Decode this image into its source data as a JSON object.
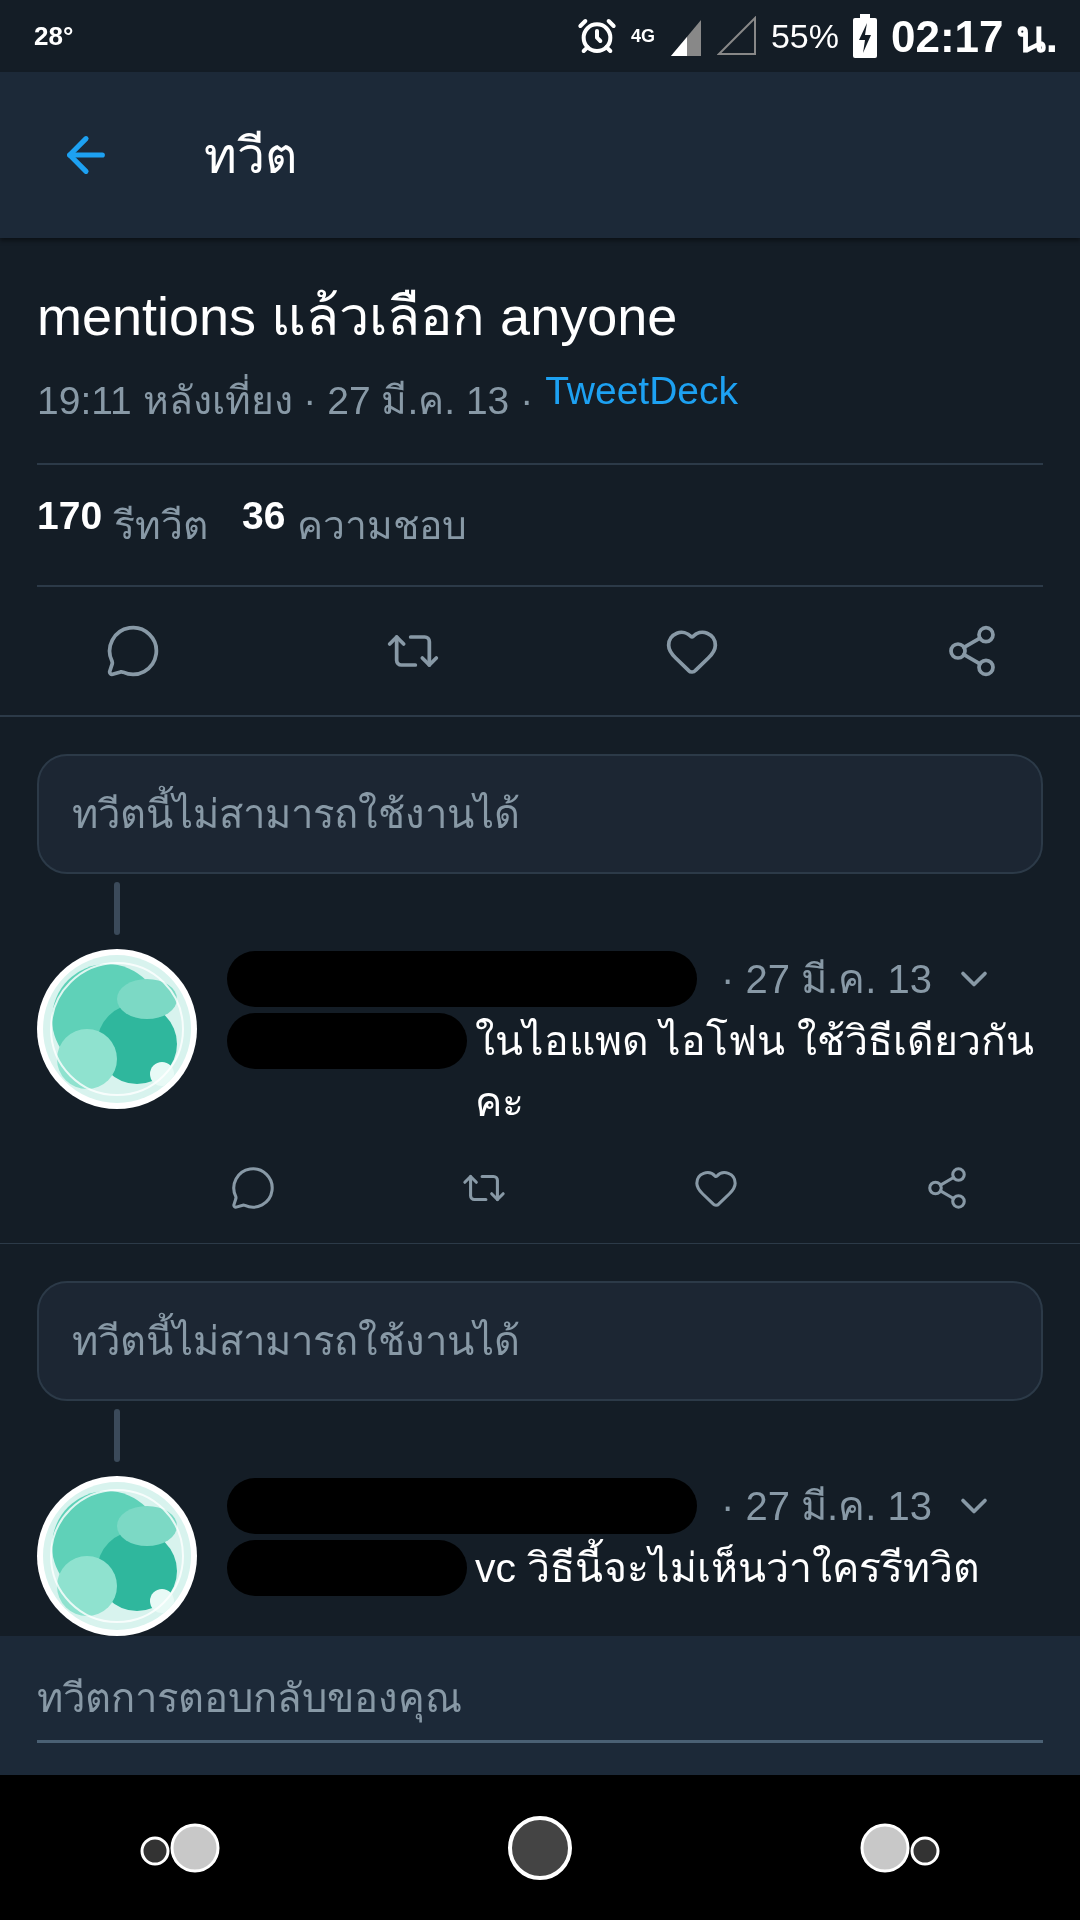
{
  "status_bar": {
    "temperature": "28°",
    "network": "4G",
    "battery": "55%",
    "time": "02:17 น."
  },
  "header": {
    "title": "ทวีต"
  },
  "tweet": {
    "text": "mentions แล้วเลือก anyone",
    "meta": "19:11 หลังเที่ยง · 27 มี.ค. 13 ·",
    "source": "TweetDeck",
    "retweet_count": "170",
    "retweet_label": "รีทวีต",
    "like_count": "36",
    "like_label": "ความชอบ"
  },
  "thread": [
    {
      "unavailable": "ทวีตนี้ไม่สามารถใช้งานได้",
      "date": "· 27 มี.ค. 13",
      "text": "ในไอแพด ไอโฟน ใช้วิธีเดียวกัน คะ",
      "actions": true
    },
    {
      "unavailable": "ทวีตนี้ไม่สามารถใช้งานได้",
      "date": "· 27 มี.ค. 13",
      "text": "vc วิธีนี้จะไม่เห็นว่าใครรีทวิต",
      "actions": false
    }
  ],
  "composer": {
    "placeholder": "ทวีตการตอบกลับของคุณ"
  }
}
